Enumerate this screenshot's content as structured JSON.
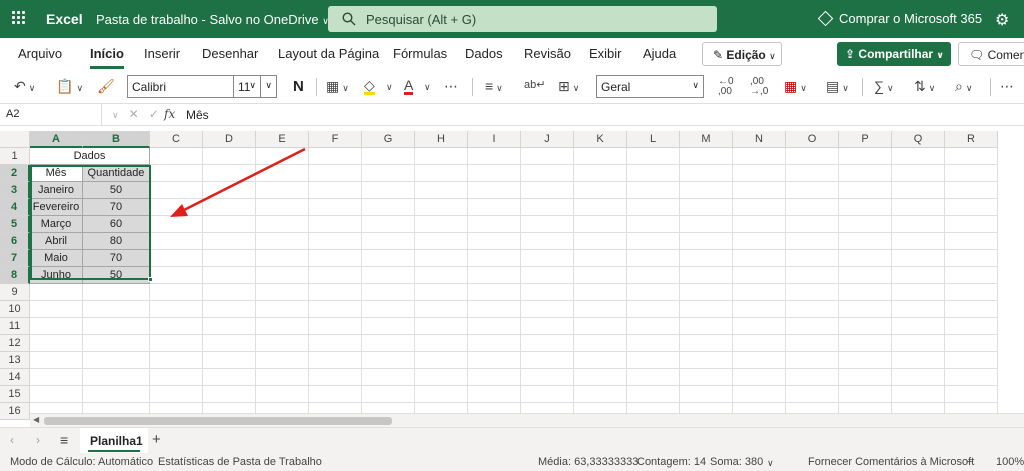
{
  "titlebar": {
    "app_name": "Excel",
    "doc_title": "Pasta de trabalho  -  Salvo no OneDrive",
    "search_placeholder": "Pesquisar (Alt + G)",
    "buy_label": "Comprar o Microsoft 365"
  },
  "tabs": [
    "Arquivo",
    "Início",
    "Inserir",
    "Desenhar",
    "Layout da Página",
    "Fórmulas",
    "Dados",
    "Revisão",
    "Exibir",
    "Ajuda"
  ],
  "active_tab": "Início",
  "buttons": {
    "edit": "Edição",
    "share": "Compartilhar",
    "comments": "Comentários"
  },
  "ribbon": {
    "font_name": "Calibri",
    "font_size": "11",
    "number_format": "Geral"
  },
  "formula_bar": {
    "name_box": "A2",
    "fx": "fx",
    "content": "Mês"
  },
  "columns": [
    "A",
    "B",
    "C",
    "D",
    "E",
    "F",
    "G",
    "H",
    "I",
    "J",
    "K",
    "L",
    "M",
    "N",
    "O",
    "P",
    "Q",
    "R"
  ],
  "rows": [
    "1",
    "2",
    "3",
    "4",
    "5",
    "6",
    "7",
    "8",
    "9",
    "10",
    "11",
    "12",
    "13",
    "14",
    "15",
    "16"
  ],
  "selected_columns": [
    "A",
    "B"
  ],
  "selected_rows": [
    "2",
    "3",
    "4",
    "5",
    "6",
    "7",
    "8"
  ],
  "sheet": {
    "merged_title": "Dados",
    "headers": [
      "Mês",
      "Quantidade"
    ],
    "data": [
      [
        "Janeiro",
        "50"
      ],
      [
        "Fevereiro",
        "70"
      ],
      [
        "Março",
        "60"
      ],
      [
        "Abril",
        "80"
      ],
      [
        "Maio",
        "70"
      ],
      [
        "Junho",
        "50"
      ]
    ]
  },
  "sheet_tabs": [
    "Planilha1"
  ],
  "statusbar": {
    "calc_mode": "Modo de Cálculo: Automático",
    "stats": "Estatísticas de Pasta de Trabalho",
    "average": "Média: 63,33333333",
    "count": "Contagem: 14",
    "sum": "Soma: 380",
    "feedback": "Fornecer Comentários à Microsoft",
    "zoom": "100%"
  },
  "colors": {
    "brand": "#1e7145",
    "annotation_arrow": "#e0201b"
  }
}
